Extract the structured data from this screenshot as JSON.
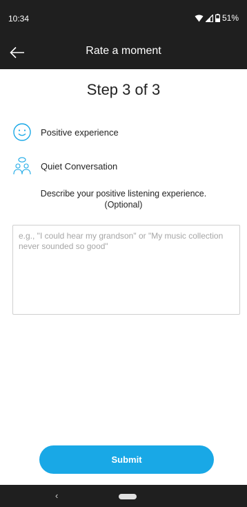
{
  "status": {
    "time": "10:34",
    "battery": "51%"
  },
  "header": {
    "title": "Rate a moment",
    "back_icon": "arrow-left-icon"
  },
  "step": "Step 3 of 3",
  "experience": {
    "label": "Positive experience",
    "icon": "smiley-icon",
    "color": "#19a8e6"
  },
  "situation": {
    "label": "Quiet Conversation",
    "icon": "conversation-icon"
  },
  "description": {
    "text": "Describe your positive listening experience. (Optional)",
    "placeholder": "e.g., \"I could hear my grandson\" or \"My music collection never sounded so good\"",
    "value": ""
  },
  "submit_label": "Submit",
  "colors": {
    "accent": "#19a8e6",
    "bar": "#1f1f1f"
  }
}
